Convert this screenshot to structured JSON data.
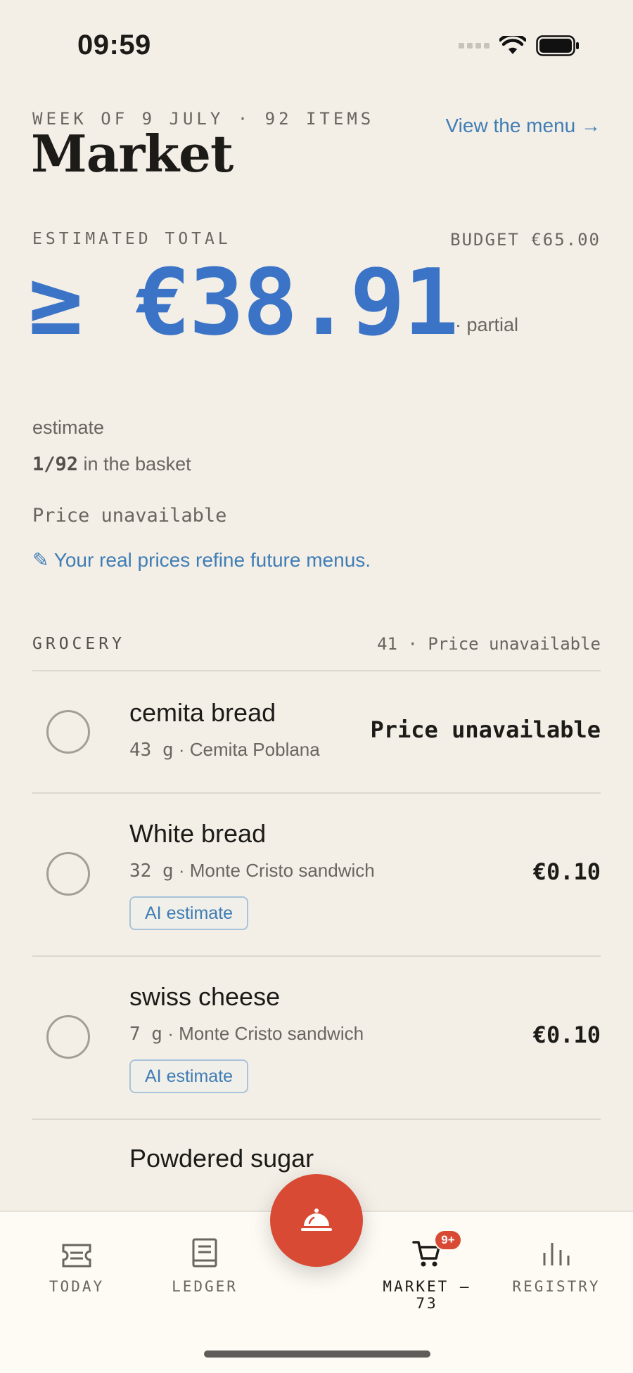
{
  "status_bar": {
    "time": "09:59"
  },
  "header": {
    "week_label": "WEEK OF 9 JULY · 92 ITEMS",
    "title": "Market",
    "view_menu_link": "View the menu →"
  },
  "summary": {
    "estimated_total_label": "ESTIMATED TOTAL",
    "budget": "BUDGET €65.00",
    "total": "≥ €38.91",
    "partial_note": "· partial",
    "estimate_label": "estimate",
    "basket_count": "1/92",
    "basket_suffix": " in the basket",
    "price_status": "Price unavailable",
    "refine_note": "✎ Your real prices refine future menus."
  },
  "grocery": {
    "section_title": "GROCERY",
    "section_meta": "41 · Price unavailable",
    "items": [
      {
        "name": "cemita bread",
        "qty": "43  g",
        "source": " · Cemita Poblana",
        "price": "Price unavailable",
        "badge": ""
      },
      {
        "name": "White bread",
        "qty": "32  g",
        "source": " · Monte Cristo sandwich",
        "price": "€0.10",
        "badge": "AI estimate"
      },
      {
        "name": "swiss cheese",
        "qty": "7  g",
        "source": " · Monte Cristo sandwich",
        "price": "€0.10",
        "badge": "AI estimate"
      },
      {
        "name": "Powdered sugar",
        "qty": "",
        "source": "",
        "price": "",
        "badge": ""
      }
    ]
  },
  "nav": {
    "items": [
      {
        "label": "TODAY",
        "icon": "ticket-icon"
      },
      {
        "label": "LEDGER",
        "icon": "book-icon"
      },
      {
        "label": "MARKET — 73",
        "icon": "cart-icon",
        "badge": "9+"
      },
      {
        "label": "REGISTRY",
        "icon": "bar-chart-icon"
      }
    ],
    "fab_icon": "cloche-icon"
  },
  "colors": {
    "accent_blue": "#3b73c6",
    "link_blue": "#3f7db5",
    "fab_red": "#d94a35",
    "background": "#f3efe7"
  }
}
